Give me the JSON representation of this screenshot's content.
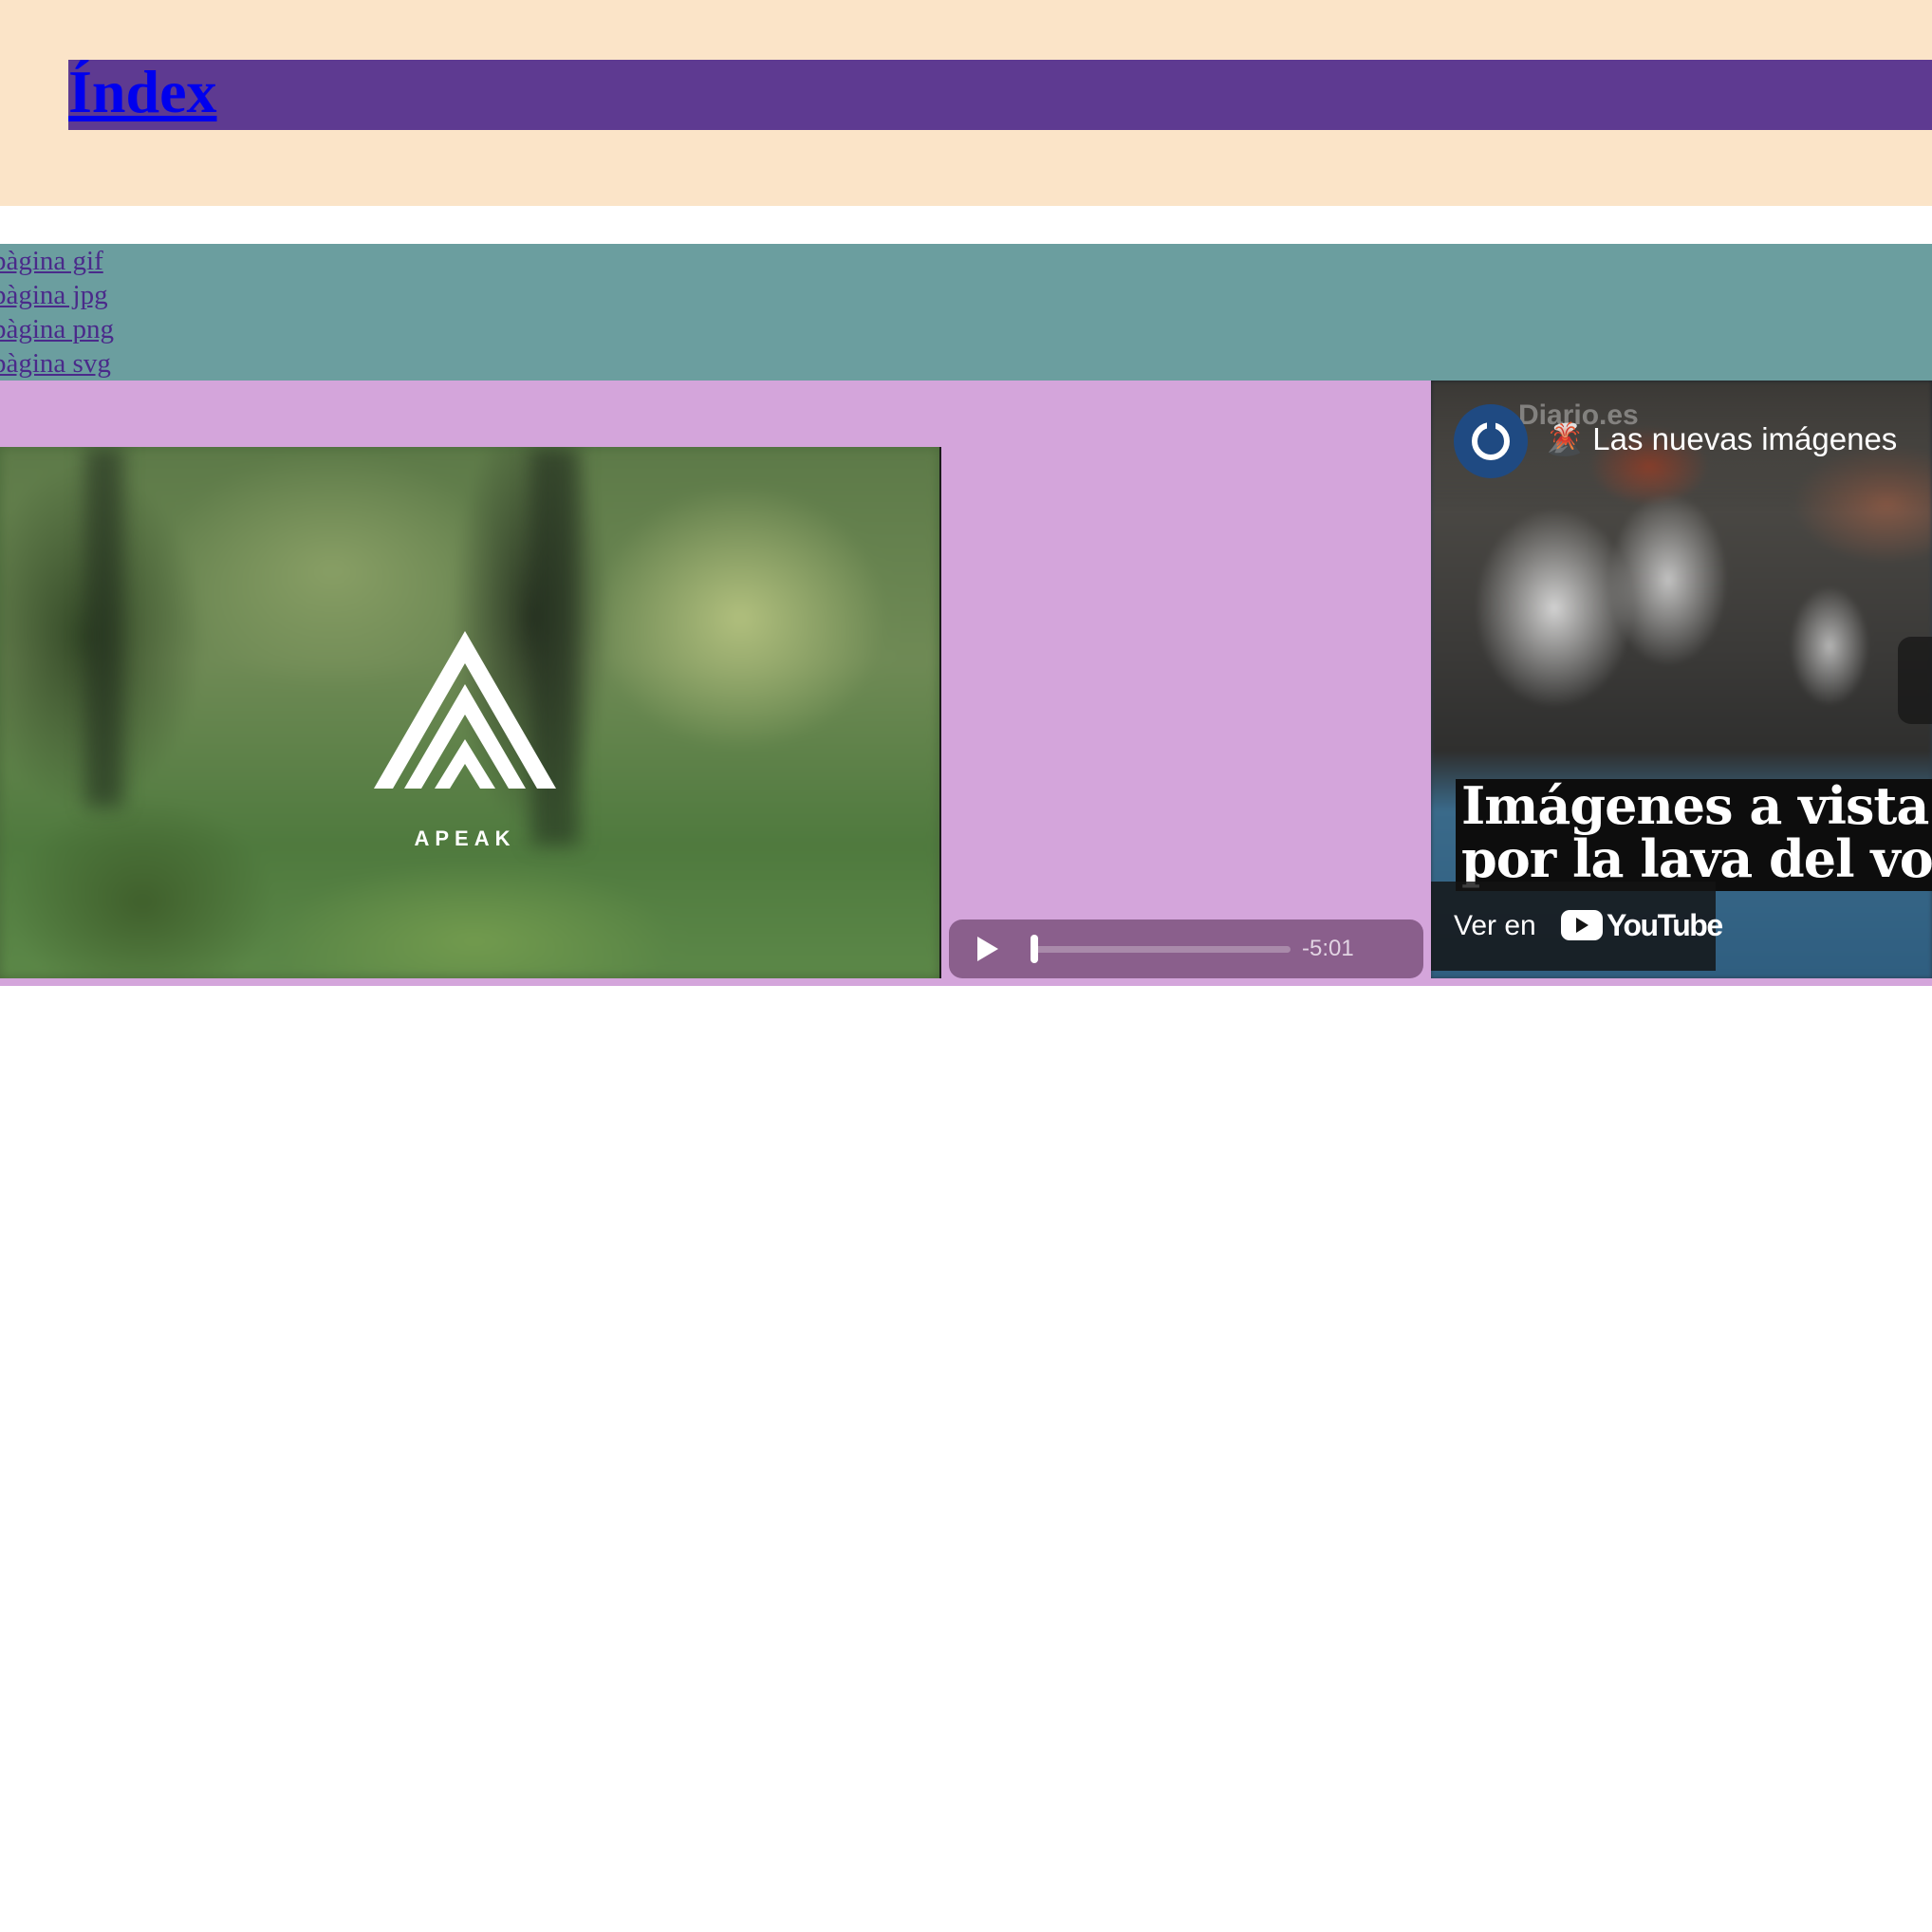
{
  "header": {
    "title": "Índex",
    "colors": {
      "background": "#fbe4c8",
      "title_bar": "#5e3a91",
      "link": "#0000ee"
    }
  },
  "nav": {
    "background": "#6b9e9f",
    "links": [
      {
        "label": "pàgina gif"
      },
      {
        "label": "pàgina jpg"
      },
      {
        "label": "pàgina png"
      },
      {
        "label": "pàgina svg"
      }
    ]
  },
  "media": {
    "background": "#d4a5db",
    "video": {
      "logo_text": "APEAK",
      "logo_icon": "mountain-logo-icon"
    },
    "audio": {
      "play_icon": "play-icon",
      "time_remaining": "-5:01",
      "progress": 0.0
    },
    "youtube": {
      "channel_name": "Diario.es",
      "channel_icon": "channel-logo-icon",
      "video_title": "🌋 Las nuevas imágenes",
      "headline_lines": [
        "Imágenes a vista de",
        "por la lava del volcán"
      ],
      "watch_on_label": "Ver en",
      "youtube_wordmark": "YouTube"
    }
  }
}
